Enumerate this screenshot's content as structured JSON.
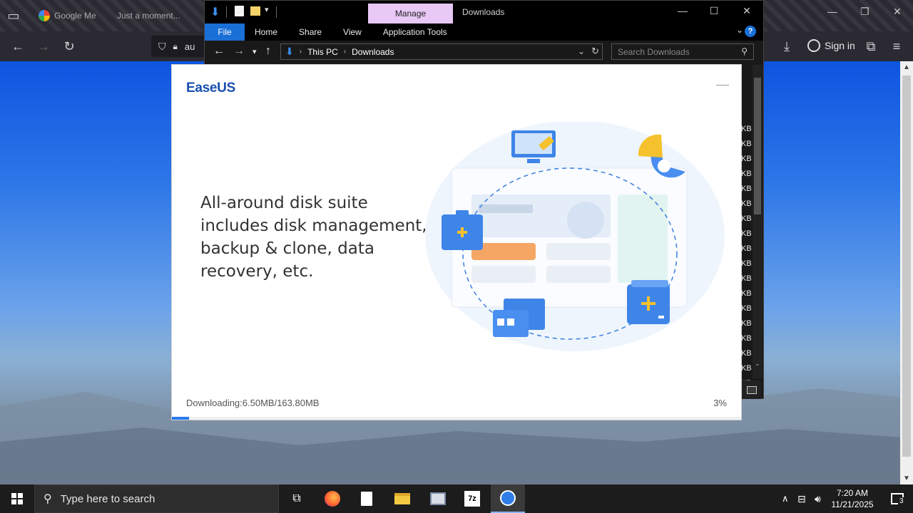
{
  "browser": {
    "tabs": [
      {
        "label": "Google Me"
      },
      {
        "label": "Just a moment..."
      }
    ],
    "url_fragment": "au",
    "sign_in": "Sign in"
  },
  "explorer": {
    "manage_tab": "Manage",
    "title": "Downloads",
    "ribbon_tabs": [
      "File",
      "Home",
      "Share",
      "View",
      "Application Tools"
    ],
    "breadcrumb": [
      "This PC",
      "Downloads"
    ],
    "search_placeholder": "Search Downloads",
    "size_units": [
      "KB",
      "KB",
      "KB",
      "KB",
      "KB",
      "KB",
      "KB",
      "KB",
      "KB",
      "KB",
      "KB",
      "KB",
      "KB",
      "KB",
      "KB",
      "KB",
      "KB",
      "KB"
    ]
  },
  "installer": {
    "logo": "EaseUS",
    "headline": "All-around disk suite includes disk management, backup & clone, data recovery, etc.",
    "status": "Downloading:6.50MB/163.80MB",
    "percent_label": "3%",
    "progress_fraction": 0.03,
    "accent": "#2a7af0"
  },
  "taskbar": {
    "search_placeholder": "Type here to search",
    "time": "7:20 AM",
    "date": "11/21/2025",
    "notification_count": "3"
  }
}
